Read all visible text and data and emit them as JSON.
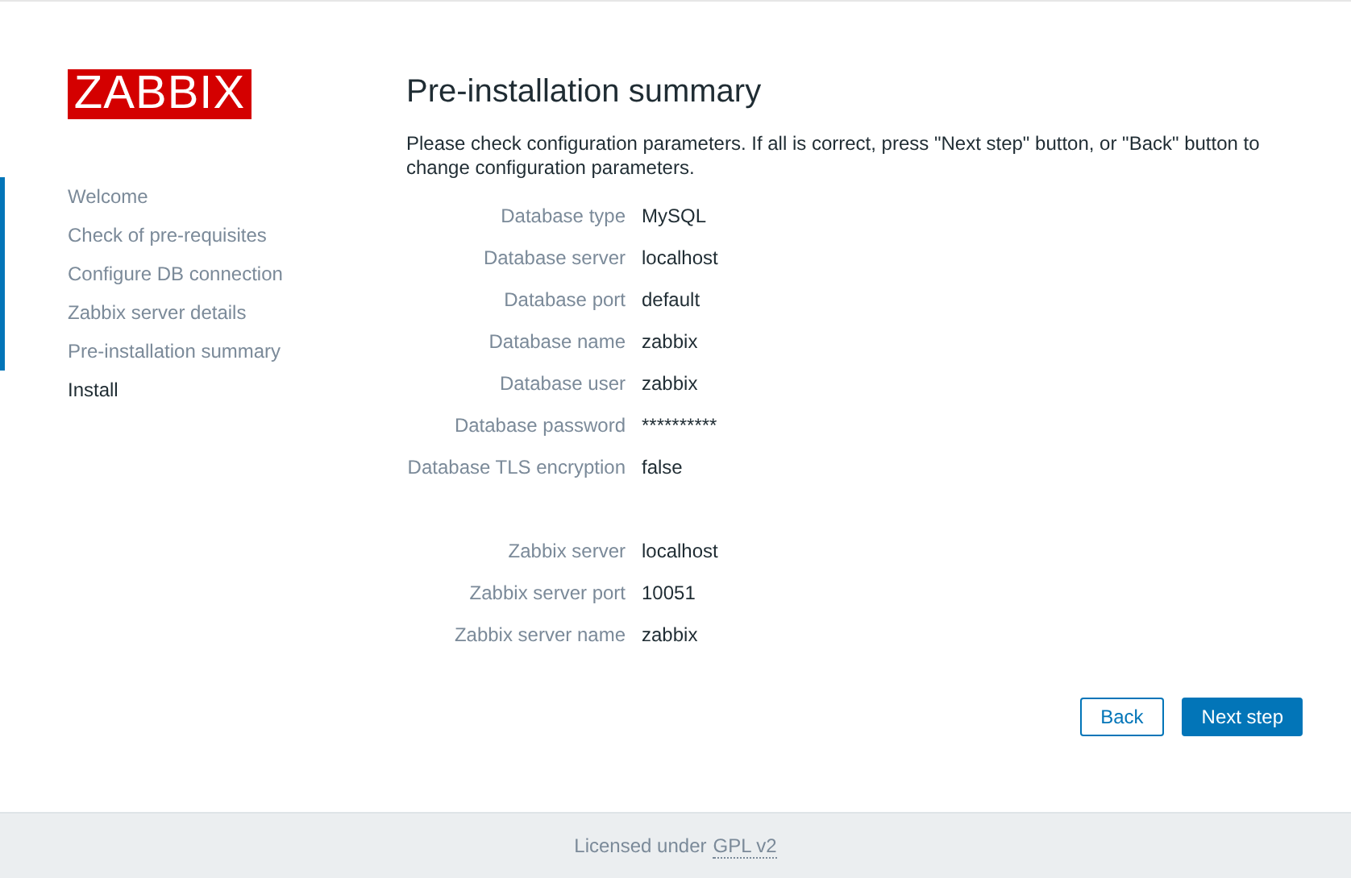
{
  "logo": {
    "text": "ZABBIX"
  },
  "steps": [
    {
      "label": "Welcome",
      "done": true,
      "selected": false
    },
    {
      "label": "Check of pre-requisites",
      "done": true,
      "selected": false
    },
    {
      "label": "Configure DB connection",
      "done": true,
      "selected": false
    },
    {
      "label": "Zabbix server details",
      "done": true,
      "selected": false
    },
    {
      "label": "Pre-installation summary",
      "done": true,
      "selected": false
    },
    {
      "label": "Install",
      "done": false,
      "selected": true
    }
  ],
  "title": "Pre-installation summary",
  "description": "Please check configuration parameters. If all is correct, press \"Next step\" button, or \"Back\" button to change configuration parameters.",
  "sections": [
    {
      "rows": [
        {
          "label": "Database type",
          "value": "MySQL"
        },
        {
          "label": "Database server",
          "value": "localhost"
        },
        {
          "label": "Database port",
          "value": "default"
        },
        {
          "label": "Database name",
          "value": "zabbix"
        },
        {
          "label": "Database user",
          "value": "zabbix"
        },
        {
          "label": "Database password",
          "value": "**********"
        },
        {
          "label": "Database TLS encryption",
          "value": "false"
        }
      ]
    },
    {
      "rows": [
        {
          "label": "Zabbix server",
          "value": "localhost"
        },
        {
          "label": "Zabbix server port",
          "value": "10051"
        },
        {
          "label": "Zabbix server name",
          "value": "zabbix"
        }
      ]
    }
  ],
  "buttons": [
    {
      "label": "Back",
      "kind": "secondary"
    },
    {
      "label": "Next step",
      "kind": "primary"
    }
  ],
  "footer": {
    "text": "Licensed under",
    "link": "GPL v2"
  }
}
